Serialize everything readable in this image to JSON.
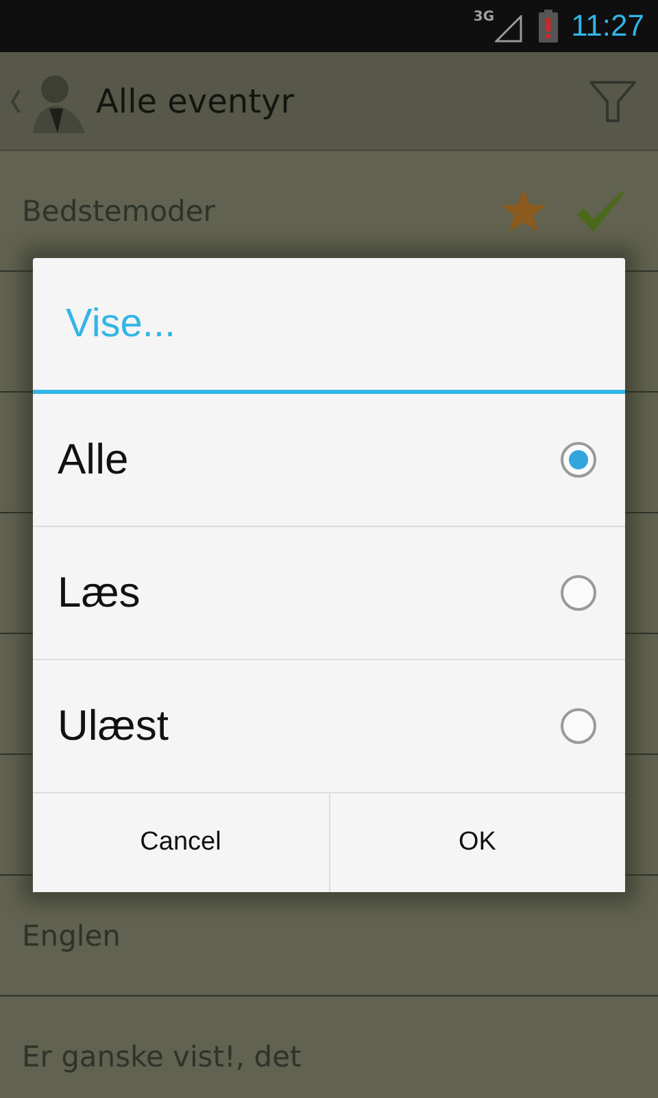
{
  "status_bar": {
    "network": "3G",
    "time": "11:27"
  },
  "action_bar": {
    "title": "Alle eventyr"
  },
  "list": [
    {
      "kind": "story",
      "title": "Bedstemoder",
      "favorite": true,
      "read": true
    },
    {
      "kind": "covered"
    },
    {
      "kind": "covered"
    },
    {
      "kind": "covered"
    },
    {
      "kind": "covered"
    },
    {
      "kind": "covered"
    },
    {
      "kind": "story",
      "title": "Englen",
      "favorite": false,
      "read": false
    },
    {
      "kind": "story",
      "title": "Er ganske vist!, det",
      "favorite": false,
      "read": false
    }
  ],
  "dialog": {
    "title": "Vise...",
    "options": [
      {
        "label": "Alle",
        "selected": true
      },
      {
        "label": "Læs",
        "selected": false
      },
      {
        "label": "Ulæst",
        "selected": false
      }
    ],
    "buttons": [
      "Cancel",
      "OK"
    ]
  }
}
